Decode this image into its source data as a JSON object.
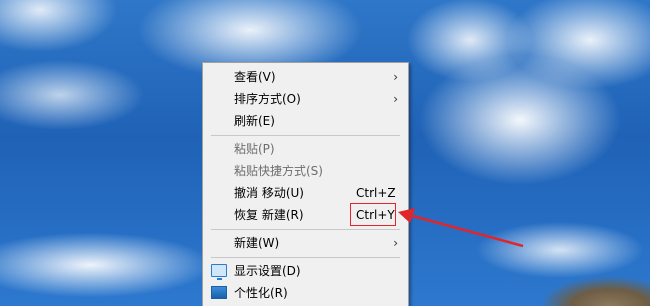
{
  "context_menu": {
    "items": [
      {
        "label": "查看(V)",
        "submenu": true
      },
      {
        "label": "排序方式(O)",
        "submenu": true
      },
      {
        "label": "刷新(E)"
      },
      {
        "label": "粘贴(P)",
        "disabled": true
      },
      {
        "label": "粘贴快捷方式(S)",
        "disabled": true
      },
      {
        "label": "撤消 移动(U)",
        "shortcut": "Ctrl+Z"
      },
      {
        "label": "恢复 新建(R)",
        "shortcut": "Ctrl+Y"
      },
      {
        "label": "新建(W)",
        "submenu": true
      },
      {
        "label": "显示设置(D)",
        "icon": "display-icon"
      },
      {
        "label": "个性化(R)",
        "icon": "personalize-icon"
      }
    ],
    "chevron": "›"
  },
  "annotation": {
    "color": "#e0262b"
  }
}
